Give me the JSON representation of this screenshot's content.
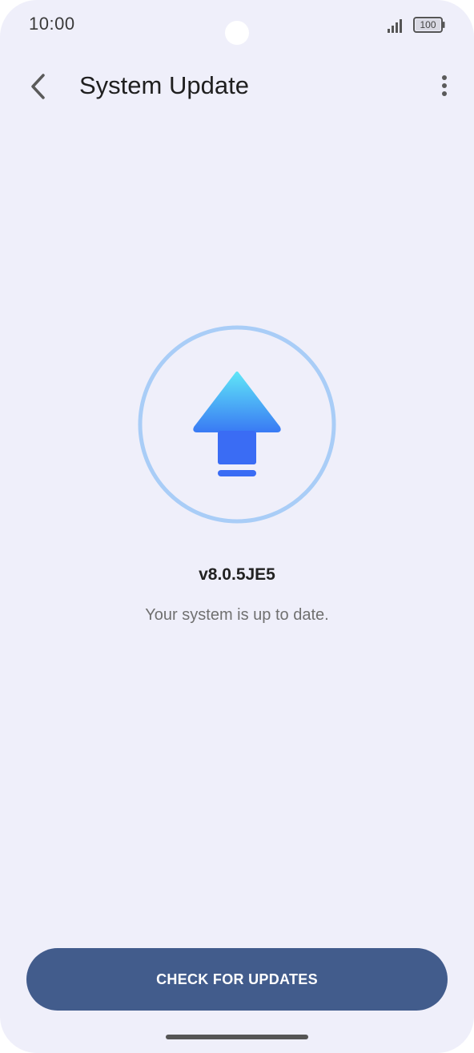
{
  "status_bar": {
    "time": "10:00",
    "battery_level": "100",
    "signal_icon": "signal-bars-icon",
    "battery_icon": "battery-icon"
  },
  "app_bar": {
    "back_icon": "chevron-left-icon",
    "title": "System Update",
    "more_icon": "more-vertical-icon"
  },
  "main": {
    "illustration_icon": "upload-arrow-icon",
    "version": "v8.0.5JE5",
    "status_message": "Your system is up to date."
  },
  "footer": {
    "check_button_label": "CHECK FOR UPDATES"
  },
  "colors": {
    "background": "#efeffa",
    "button": "#425c8c",
    "ring": "#a9cdf7",
    "arrow_top": "#5fe3f7",
    "arrow_bottom": "#3a6cf4"
  }
}
